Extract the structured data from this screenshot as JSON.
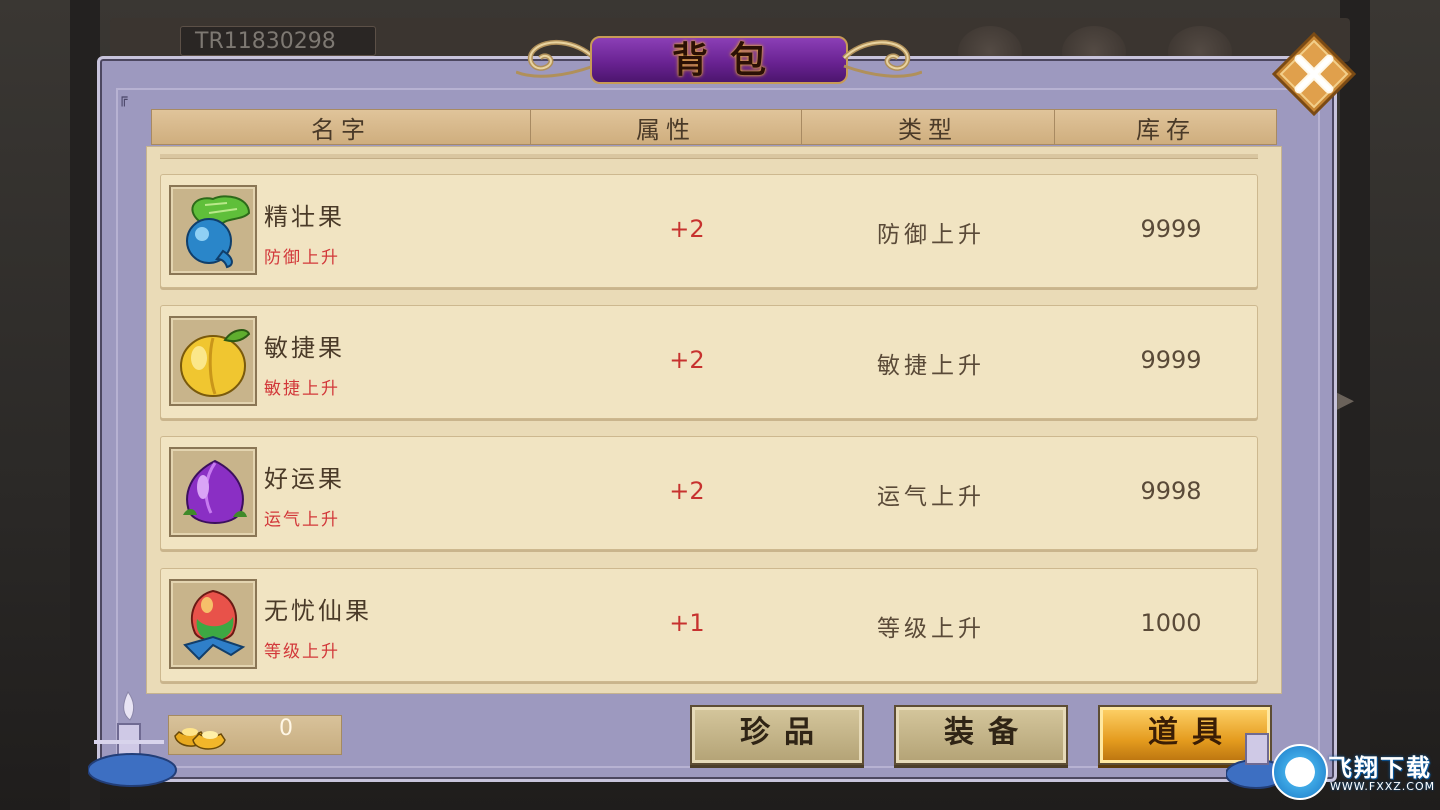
{
  "background": {
    "player_id": "TR11830298"
  },
  "title": "背包",
  "table": {
    "columns": [
      "名字",
      "属性",
      "类型",
      "库存"
    ]
  },
  "items": [
    {
      "name": "精壮果",
      "desc": "防御上升",
      "attr": "+2",
      "type": "防御上升",
      "stock": "9999",
      "icon": "radish-fruit-icon"
    },
    {
      "name": "敏捷果",
      "desc": "敏捷上升",
      "attr": "+2",
      "type": "敏捷上升",
      "stock": "9999",
      "icon": "peach-fruit-icon"
    },
    {
      "name": "好运果",
      "desc": "运气上升",
      "attr": "+2",
      "type": "运气上升",
      "stock": "9998",
      "icon": "purple-fruit-icon"
    },
    {
      "name": "无忧仙果",
      "desc": "等级上升",
      "attr": "+1",
      "type": "等级上升",
      "stock": "1000",
      "icon": "immortal-fruit-icon"
    }
  ],
  "currency": {
    "value": "0",
    "icon": "gold-ingot-icon"
  },
  "tabs": [
    {
      "label": "珍品",
      "active": false
    },
    {
      "label": "装备",
      "active": false
    },
    {
      "label": "道具",
      "active": true
    }
  ],
  "watermark": {
    "text": "飞翔下载",
    "url": "WWW.FXXZ.COM"
  },
  "colors": {
    "panel": "#9d99bf",
    "row_bg": "#f1e4c2",
    "desc_red": "#d2383a",
    "title_purple": "#6a2393",
    "tab_active": "#e49b1e"
  }
}
